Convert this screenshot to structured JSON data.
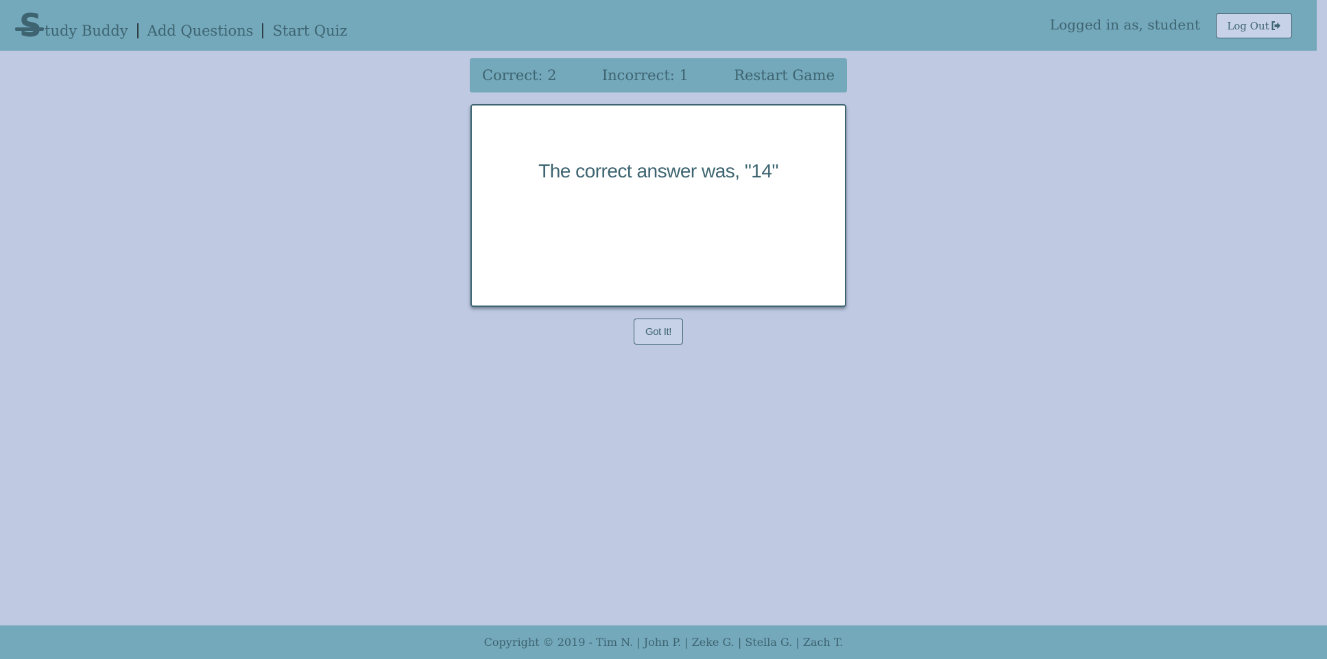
{
  "navbar": {
    "brand_rest": "tudy Buddy",
    "links": [
      "Add Questions",
      "Start Quiz"
    ],
    "logged_in_text": "Logged in as, student",
    "logout_label": "Log Out",
    "logout_icon": "sign-out-icon"
  },
  "scoreboard": {
    "correct": "Correct: 2",
    "incorrect": "Incorrect: 1",
    "restart": "Restart Game"
  },
  "card": {
    "answer_text": "The correct answer was, \"14\""
  },
  "got_it_label": "Got It!",
  "footer": {
    "text": "Copyright © 2019 - Tim N. | John P. | Zeke G. | Stella G. | Zach T."
  },
  "colors": {
    "background": "#bfc9e2",
    "bar": "#74a8bb",
    "text": "#3d6470",
    "card": "#ffffff"
  }
}
